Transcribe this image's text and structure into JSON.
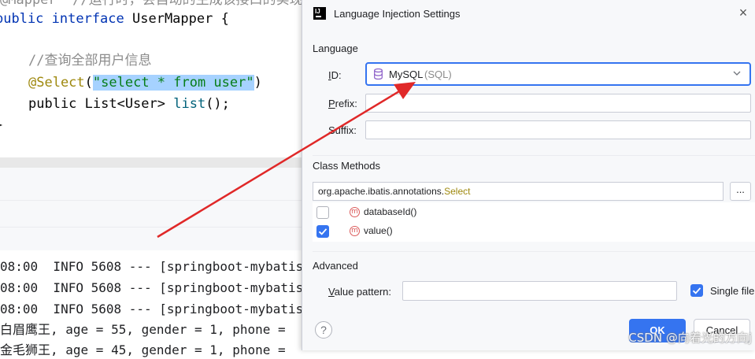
{
  "editor": {
    "line0": "@Mapper  //运行时，会自动的生成该接口的实现类",
    "line1_kw": "public interface",
    "line1_name": " UserMapper {",
    "comment": "//查询全部用户信息",
    "ann_name": "@Select",
    "ann_open": "(",
    "ann_string": "\"select * from user\"",
    "ann_close": ")",
    "method_prefix": "public List<User> ",
    "method_name": "list",
    "method_suffix": "();",
    "close_brace": "}"
  },
  "console": {
    "lines": [
      "08:00  INFO 5608 --- [springboot-mybatis",
      "08:00  INFO 5608 --- [springboot-mybatis",
      "08:00  INFO 5608 --- [springboot-mybatis",
      "白眉鹰王, age = 55, gender = 1, phone = ",
      "金毛狮王, age = 45, gender = 1, phone = "
    ]
  },
  "dialog": {
    "title": "Language Injection Settings",
    "close_glyph": "×",
    "app_icon_text": "IJ",
    "language_section": "Language",
    "id_label_letter": "I",
    "id_label_rest": "D:",
    "language_selected": "MySQL",
    "language_sub": "(SQL)",
    "prefix_letter": "P",
    "prefix_rest": "refix:",
    "suffix_label": "Suffix:",
    "prefix_value": "",
    "suffix_value": "",
    "class_methods_section": "Class Methods",
    "class_name_pkg": "org.apache.ibatis.annotations.",
    "class_name_ann": "Select",
    "browse_label": "...",
    "methods": [
      {
        "name": "databaseId()",
        "checked": false
      },
      {
        "name": "value()",
        "checked": true
      }
    ],
    "method_icon_glyph": "m",
    "advanced_section": "Advanced",
    "pattern_letter": "V",
    "pattern_rest": "alue pattern:",
    "pattern_value": "",
    "single_file_label": "Single file",
    "single_file_checked": true,
    "help_glyph": "?",
    "ok_label": "OK",
    "cancel_label": "Cancel"
  },
  "colors": {
    "accent": "#3574f0",
    "arrow": "#e02828",
    "selection": "#a6d2ff",
    "keyword": "#0033b3",
    "annotation": "#9e880d"
  },
  "watermark": "CSDN @向着光的方向j"
}
